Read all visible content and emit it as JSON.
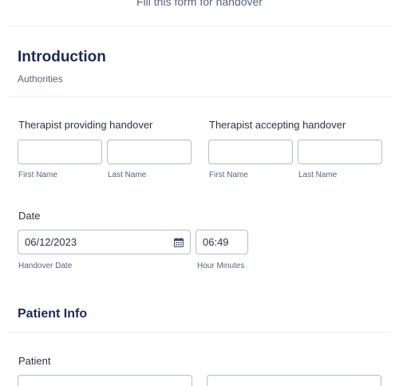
{
  "form": {
    "subheader": "Fill this form for handover"
  },
  "introduction": {
    "title": "Introduction",
    "subtitle": "Authorities"
  },
  "providing": {
    "label": "Therapist providing handover",
    "first_name_value": "",
    "last_name_value": "",
    "first_name_sublabel": "First Name",
    "last_name_sublabel": "Last Name"
  },
  "accepting": {
    "label": "Therapist accepting handover",
    "first_name_value": "",
    "last_name_value": "",
    "first_name_sublabel": "First Name",
    "last_name_sublabel": "Last Name"
  },
  "date": {
    "label": "Date",
    "date_value": "06/12/2023",
    "time_value": "06:49",
    "date_sublabel": "Handover Date",
    "time_sublabel": "Hour Minutes"
  },
  "patient_info": {
    "title": "Patient Info"
  },
  "patient": {
    "label": "Patient",
    "first_name_value": "",
    "last_name_value": ""
  },
  "icons": {
    "date_picker": "calendar-icon"
  },
  "colors": {
    "heading": "#1e2a5a",
    "border": "#b8bdc9",
    "muted_text": "#57647e"
  }
}
